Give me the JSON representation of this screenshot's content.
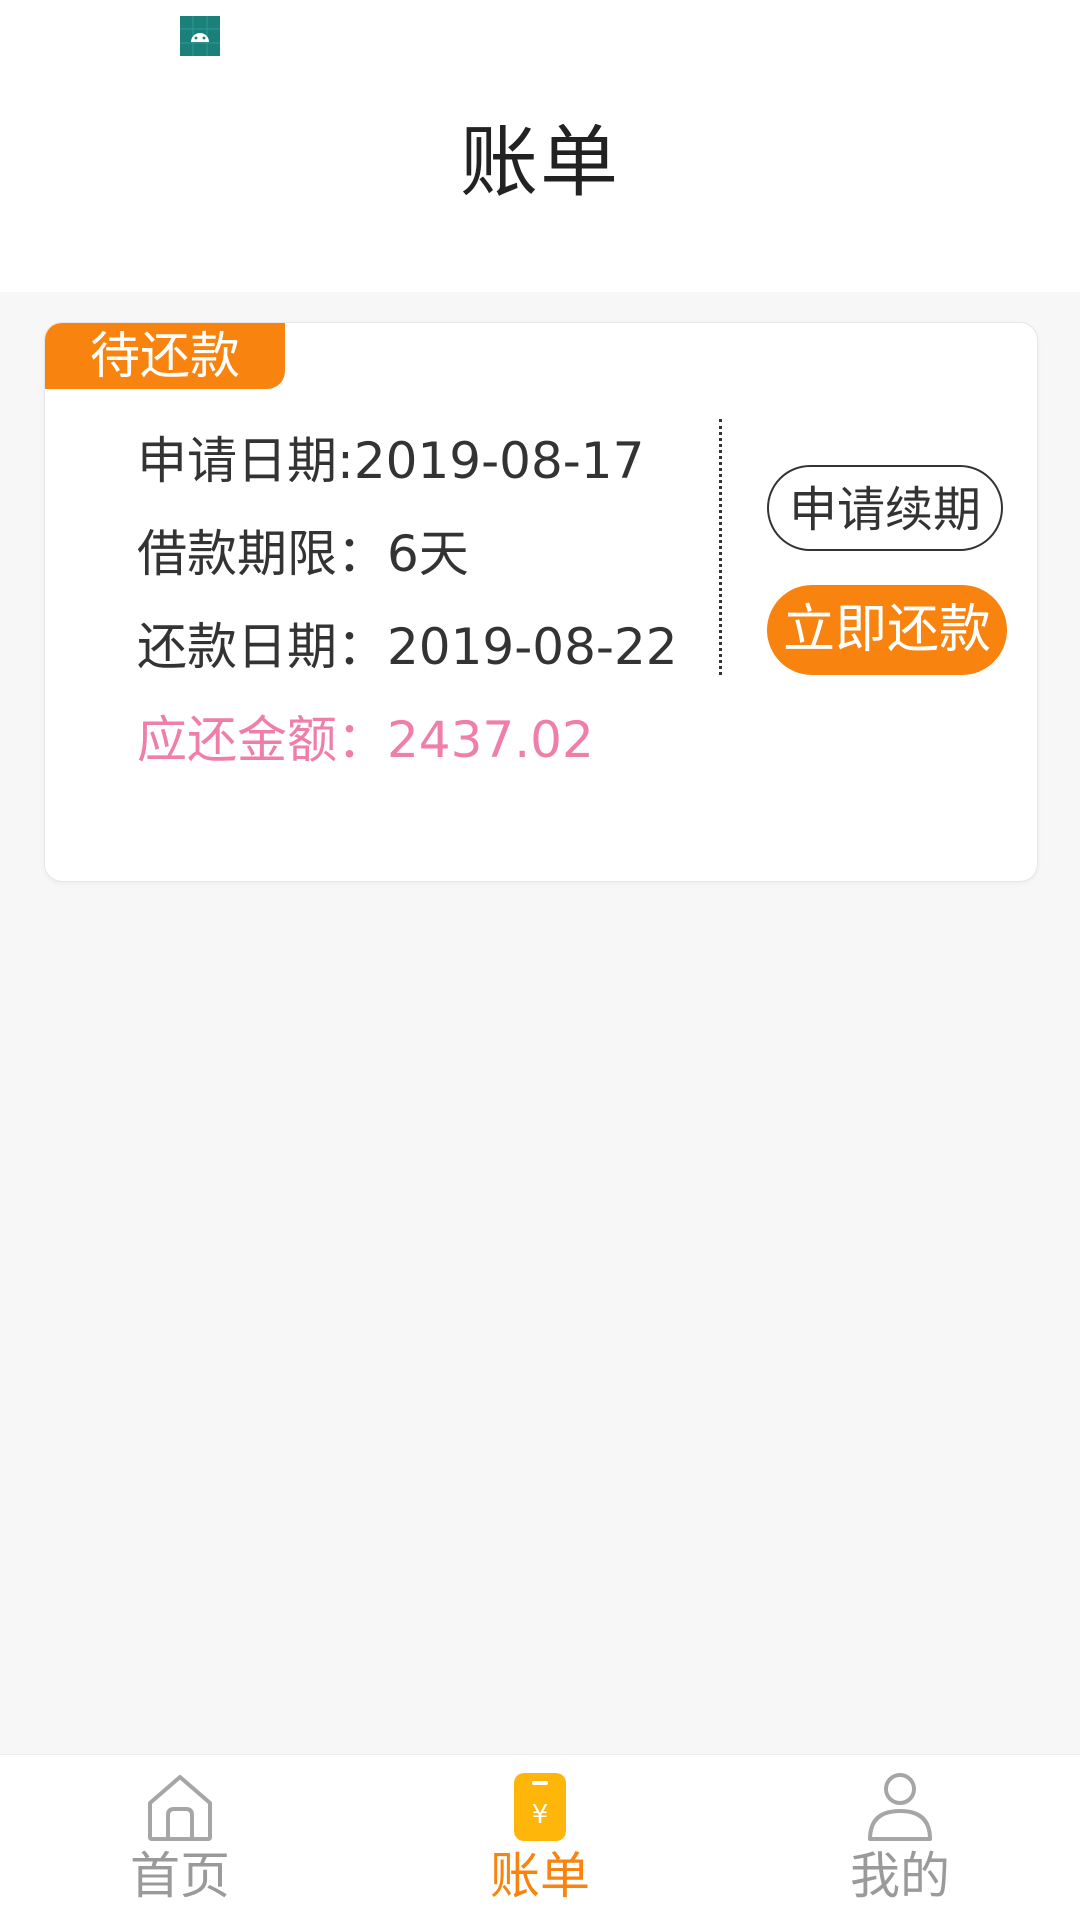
{
  "header": {
    "title": "账单"
  },
  "bill": {
    "status_tag": "待还款",
    "apply_date": "申请日期:2019-08-17",
    "loan_term": "借款期限：6天",
    "repay_date": "还款日期：2019-08-22",
    "amount_due": "应还金额：2437.02",
    "renew_button": "申请续期",
    "pay_button": "立即还款"
  },
  "nav": {
    "items": [
      {
        "label": "首页",
        "icon": "home-icon",
        "active": false
      },
      {
        "label": "账单",
        "icon": "bill-icon",
        "active": true
      },
      {
        "label": "我的",
        "icon": "user-icon",
        "active": false
      }
    ]
  },
  "colors": {
    "accent": "#f8830f",
    "amount": "#ef7fa8",
    "inactive": "#9a9a9a"
  }
}
